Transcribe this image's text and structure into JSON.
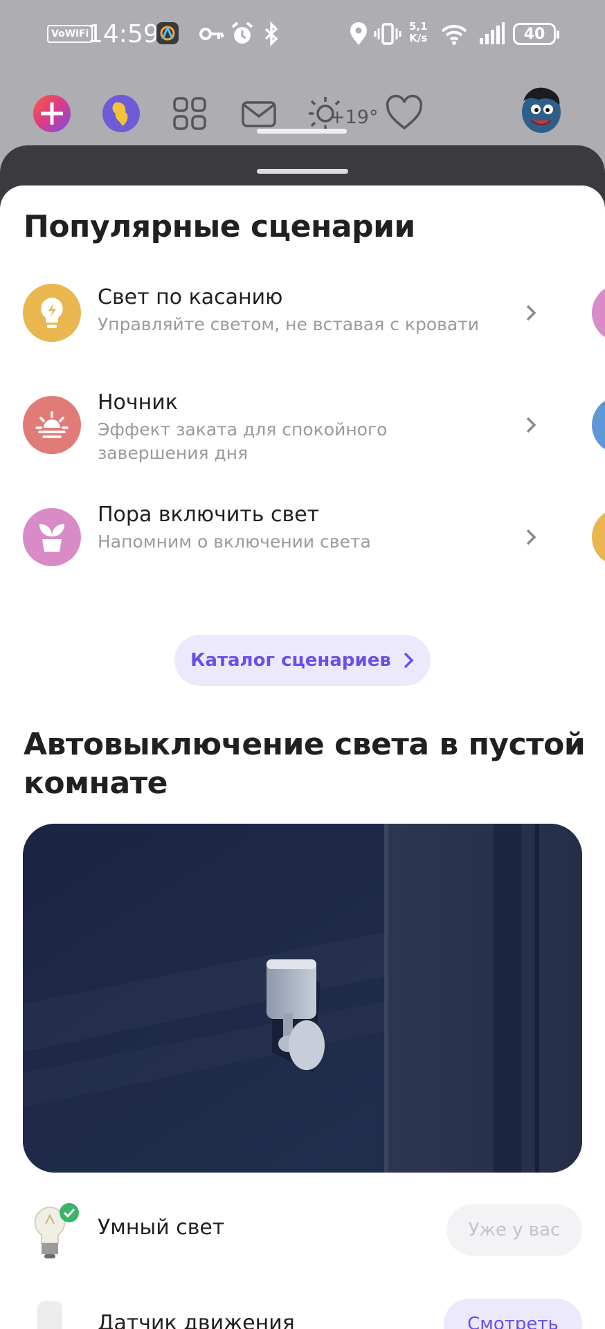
{
  "status_bar": {
    "vowifi": "VoWiFi",
    "time": "14:59",
    "net_speed_value": "5,1",
    "net_speed_unit": "K/s",
    "battery": "40"
  },
  "top_icons": {
    "weather_temp": "+19°",
    "items": [
      "plus-app-icon",
      "globe-icon",
      "services-grid-icon",
      "mail-icon",
      "weather-icon",
      "favorites-heart-icon",
      "profile-avatar"
    ]
  },
  "popular": {
    "title": "Популярные сценарии",
    "items": [
      {
        "title": "Свет по касанию",
        "subtitle": "Управляйте светом, не вставая с кровати",
        "icon": "bulb-icon",
        "color": "#e9b64f"
      },
      {
        "title": "Ночник",
        "subtitle": "Эффект заката для спокойного завершения дня",
        "icon": "sunset-icon",
        "color": "#e07b78"
      },
      {
        "title": "Пора включить свет",
        "subtitle": "Напомним о включении света",
        "icon": "plant-icon",
        "color": "#d88bc6"
      }
    ],
    "catalog_button": "Каталог сценариев"
  },
  "auto_off": {
    "title_line1": "Автовыключение света в пустой",
    "title_line2": "комнате",
    "products": [
      {
        "name": "Умный свет",
        "action": "Уже у вас"
      },
      {
        "name": "Датчик движения",
        "action": "Смотреть"
      }
    ]
  },
  "colors": {
    "accent": "#6b4fe8",
    "accent_bg": "#ece9fd",
    "sheet_bg": "#ffffff",
    "backdrop": "#aeadb1"
  }
}
